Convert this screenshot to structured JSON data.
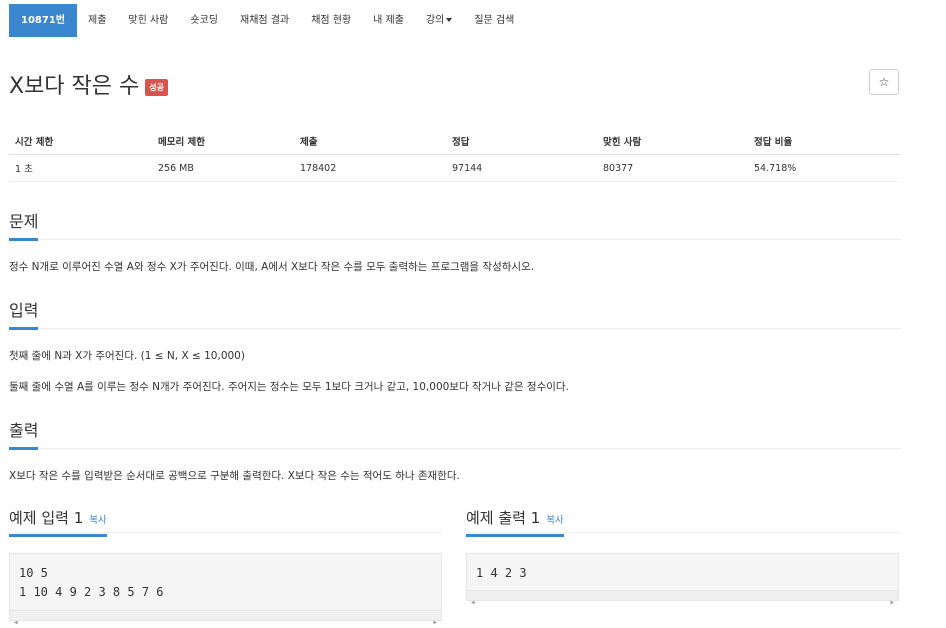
{
  "nav": {
    "items": [
      "10871번",
      "제출",
      "맞힌 사람",
      "숏코딩",
      "재채점 결과",
      "채점 현황",
      "내 제출",
      "강의",
      "질문 검색"
    ]
  },
  "problem": {
    "title": "X보다 작은 수",
    "badge": "성공",
    "star": "☆"
  },
  "info_table": {
    "headers": [
      "시간 제한",
      "메모리 제한",
      "제출",
      "정답",
      "맞힌 사람",
      "정답 비율"
    ],
    "values": [
      "1 초",
      "256 MB",
      "178402",
      "97144",
      "80377",
      "54.718%"
    ]
  },
  "sections": {
    "problem_heading": "문제",
    "problem_text": "정수 N개로 이루어진 수열 A와 정수 X가 주어진다. 이때, A에서 X보다 작은 수를 모두 출력하는 프로그램을 작성하시오.",
    "input_heading": "입력",
    "input_line1": "첫째 줄에 N과 X가 주어진다. (1 ≤ N, X ≤ 10,000)",
    "input_line2": "둘째 줄에 수열 A를 이루는 정수 N개가 주어진다. 주어지는 정수는 모두 1보다 크거나 같고, 10,000보다 작거나 같은 정수이다.",
    "output_heading": "출력",
    "output_text": "X보다 작은 수를 입력받은 순서대로 공백으로 구분해 출력한다. X보다 작은 수는 적어도 하나 존재한다."
  },
  "samples": {
    "input_title": "예제 입력 1",
    "output_title": "예제 출력 1",
    "copy_label": "복사",
    "input_lines": [
      "10 5",
      "1 10 4 9 2 3 8 5 7 6"
    ],
    "output_lines": [
      "1 4 2 3"
    ]
  },
  "colors": {
    "accent": "#3a87cf",
    "badge": "#d9534f"
  }
}
